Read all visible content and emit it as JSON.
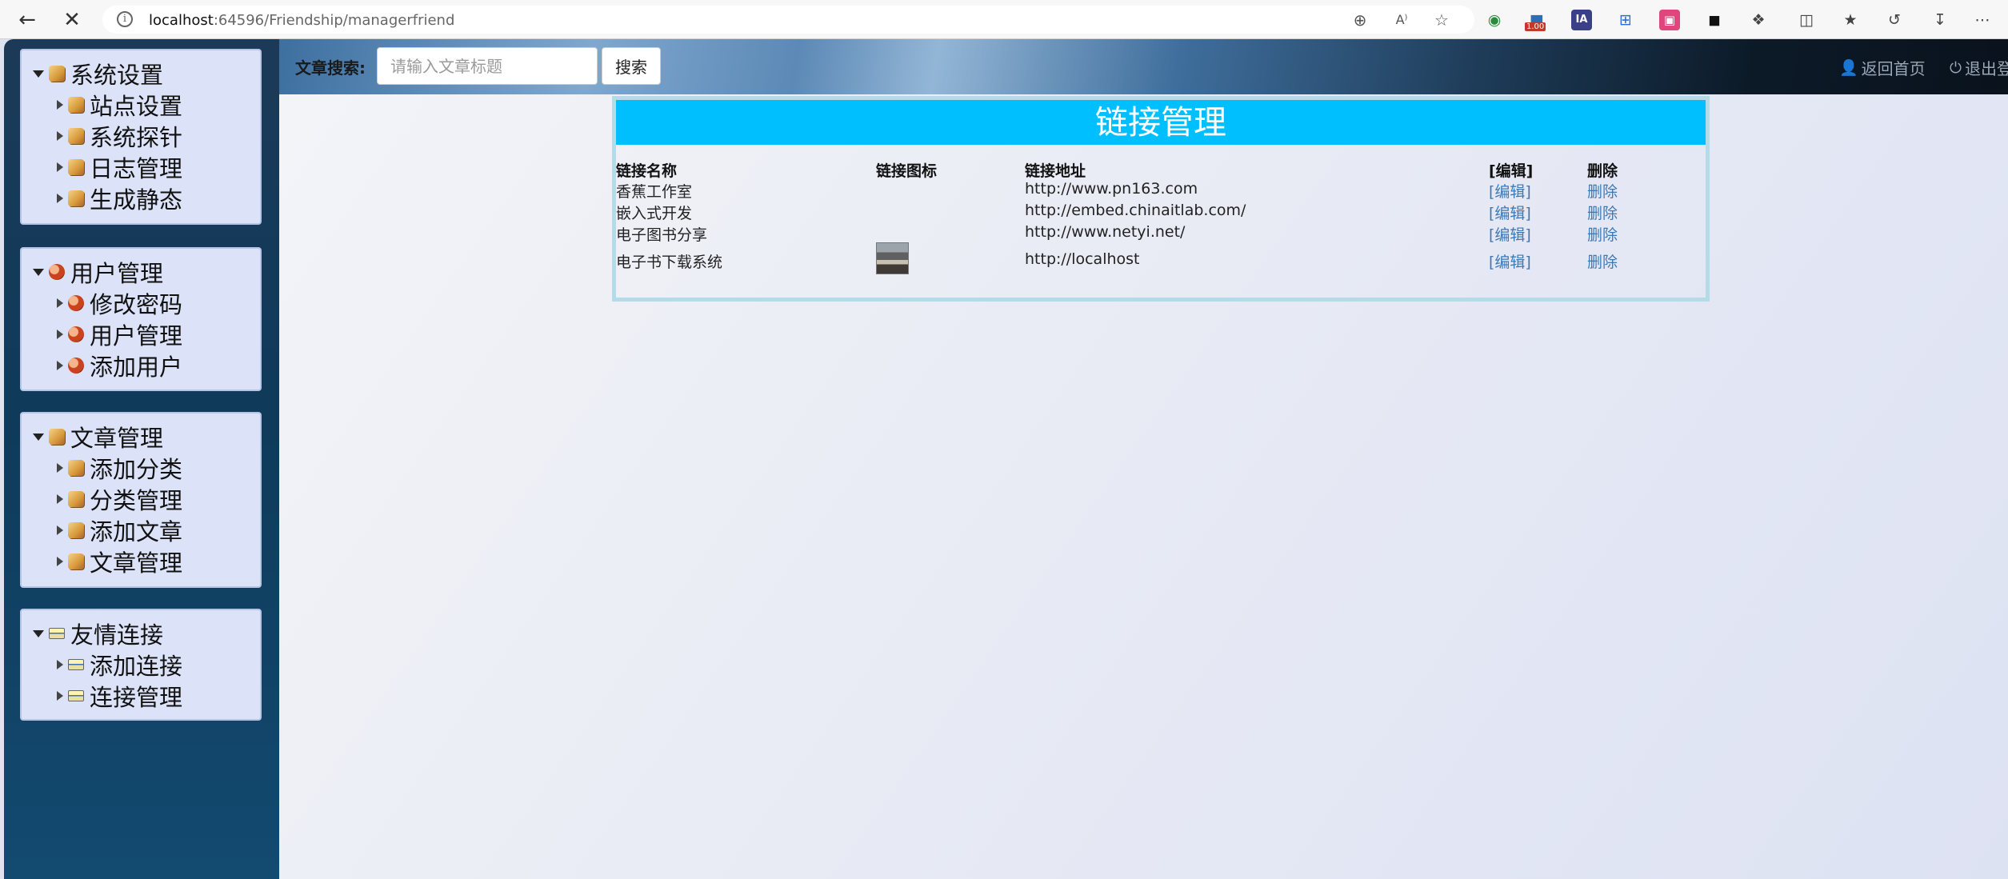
{
  "browser": {
    "url_host": "localhost",
    "url_path": ":64596/Friendship/managerfriend",
    "badge": "1.00"
  },
  "sidebar": {
    "groups": [
      {
        "title": "系统设置",
        "icon": "box-icon",
        "items": [
          "站点设置",
          "系统探针",
          "日志管理",
          "生成静态"
        ]
      },
      {
        "title": "用户管理",
        "icon": "user-icon",
        "items": [
          "修改密码",
          "用户管理",
          "添加用户"
        ]
      },
      {
        "title": "文章管理",
        "icon": "box-icon",
        "items": [
          "添加分类",
          "分类管理",
          "添加文章",
          "文章管理"
        ]
      },
      {
        "title": "友情连接",
        "icon": "card-icon",
        "items": [
          "添加连接",
          "连接管理"
        ]
      }
    ]
  },
  "header": {
    "search_label": "文章搜索:",
    "search_placeholder": "请输入文章标题",
    "search_button": "搜索",
    "home_link": "返回首页",
    "logout_link": "退出登"
  },
  "link_panel": {
    "title": "链接管理",
    "columns": [
      "链接名称",
      "链接图标",
      "链接地址",
      "[编辑]",
      "删除"
    ],
    "rows": [
      {
        "name": "香蕉工作室",
        "has_icon": false,
        "url": "http://www.pn163.com",
        "edit": "[编辑]",
        "delete": "删除"
      },
      {
        "name": "嵌入式开发",
        "has_icon": false,
        "url": "http://embed.chinaitlab.com/",
        "edit": "[编辑]",
        "delete": "删除"
      },
      {
        "name": "电子图书分享",
        "has_icon": false,
        "url": "http://www.netyi.net/",
        "edit": "[编辑]",
        "delete": "删除"
      },
      {
        "name": "电子书下载系统",
        "has_icon": true,
        "url": "http://localhost",
        "edit": "[编辑]",
        "delete": "删除"
      }
    ]
  },
  "colors": {
    "title_bar": "#00bfff",
    "link": "#3c78b5",
    "panel_border": "#b5dbe8"
  }
}
